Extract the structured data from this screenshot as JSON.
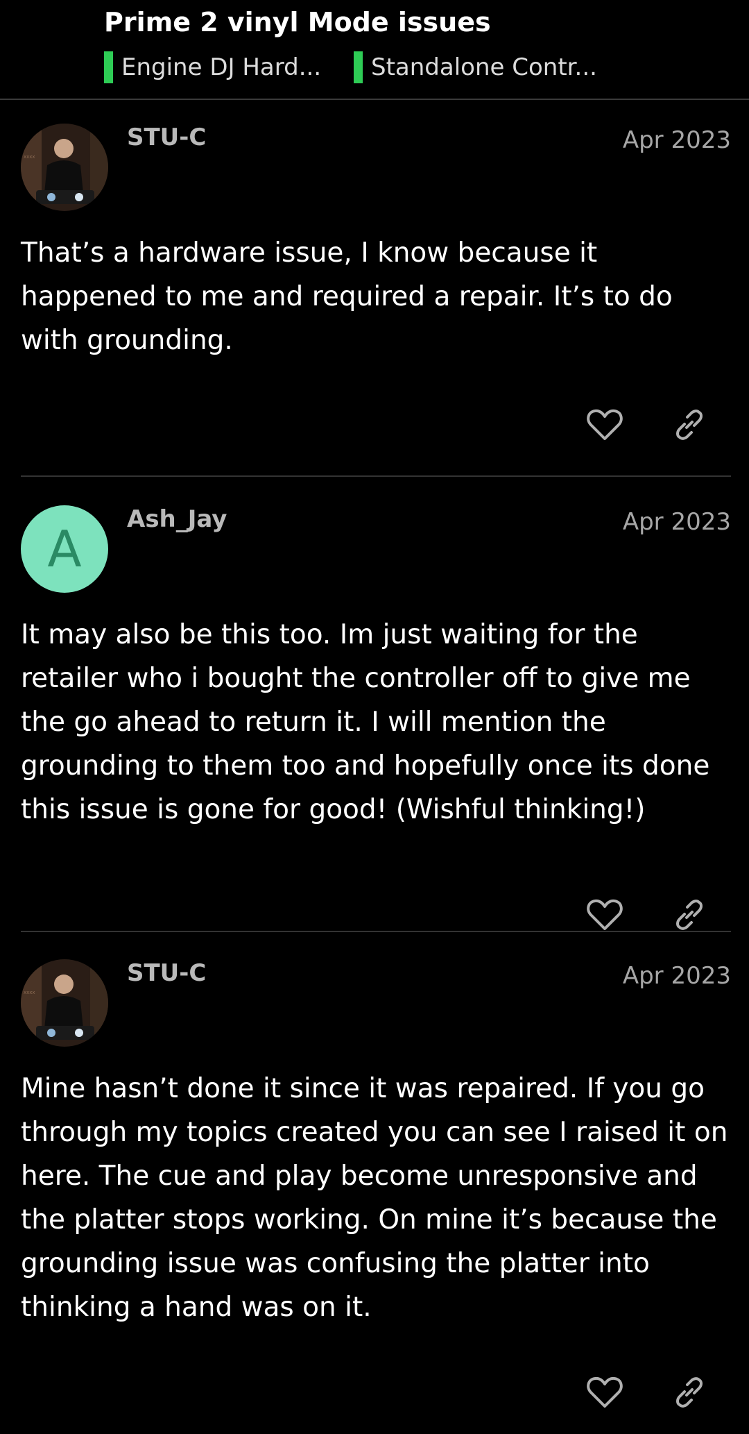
{
  "topic": {
    "title": "Prime 2 vinyl Mode issues",
    "categories": [
      {
        "label": "Engine DJ Hard...",
        "color": "#2ecc55"
      },
      {
        "label": "Standalone Contr...",
        "color": "#2ecc55"
      }
    ]
  },
  "posts": [
    {
      "username": "STU-C",
      "date": "Apr 2023",
      "avatar": "photo",
      "body": "That’s a hardware issue, I know because it happened to me and required a repair. It’s to do with grounding."
    },
    {
      "username": "Ash_Jay",
      "date": "Apr 2023",
      "avatar": "letter",
      "avatar_letter": "A",
      "avatar_color": "#7de2bd",
      "body": "It may also be this too. Im just waiting for the retailer who i bought the controller off to give me the go ahead to return it. I will mention the grounding to them too and hopefully once its done this issue is gone for good! (Wishful thinking!)"
    },
    {
      "username": "STU-C",
      "date": "Apr 2023",
      "avatar": "photo",
      "body": "Mine hasn’t done it since it was repaired. If you go through my topics created you can see I raised it on here. The cue and play become unresponsive and the platter stops working. On mine it’s because the grounding issue was confusing the platter into thinking a hand was on it."
    }
  ],
  "icons": {
    "like": "heart-icon",
    "share": "link-icon"
  }
}
